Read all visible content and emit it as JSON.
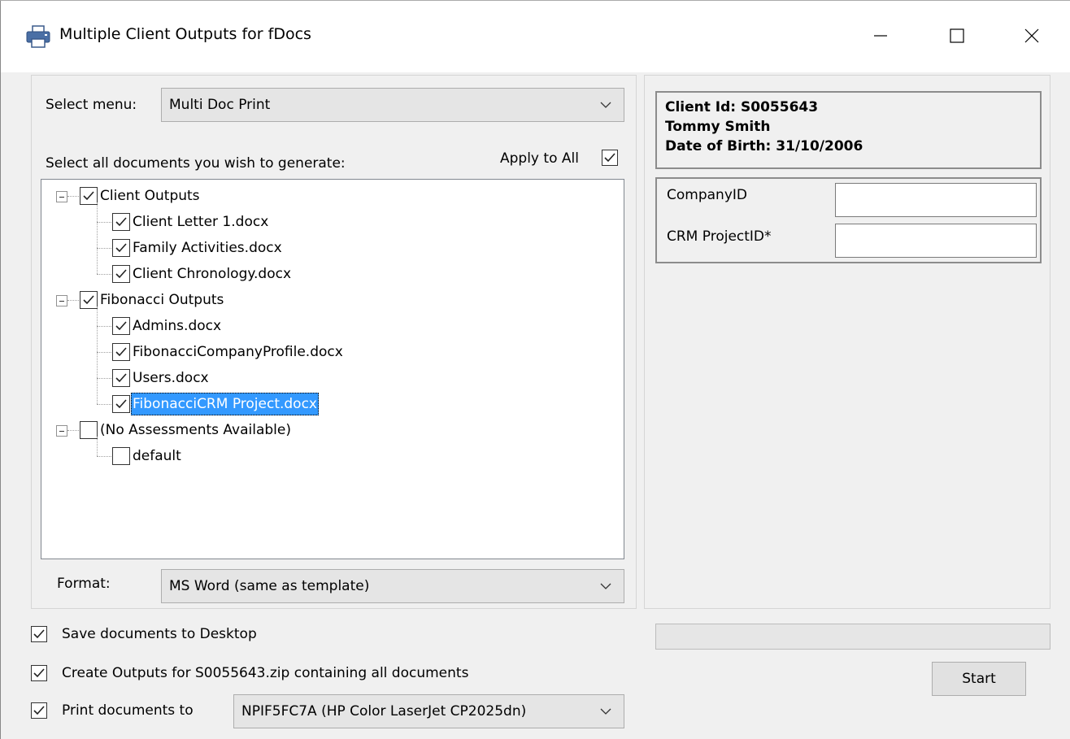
{
  "window": {
    "title": "Multiple Client Outputs for fDocs",
    "icons": {
      "app": "printer-icon",
      "minimize": "minimize-icon",
      "maximize": "maximize-icon",
      "close": "close-icon"
    }
  },
  "left": {
    "select_menu_label": "Select menu:",
    "select_menu_value": "Multi Doc Print",
    "documents_label": "Select all documents you wish to generate:",
    "apply_to_all_label": "Apply to All",
    "apply_to_all_checked": true,
    "tree": [
      {
        "label": "Client Outputs",
        "checked": true,
        "level": 0
      },
      {
        "label": "Client Letter 1.docx",
        "checked": true,
        "level": 1
      },
      {
        "label": "Family Activities.docx",
        "checked": true,
        "level": 1
      },
      {
        "label": "Client Chronology.docx",
        "checked": true,
        "level": 1
      },
      {
        "label": "Fibonacci Outputs",
        "checked": true,
        "level": 0
      },
      {
        "label": "Admins.docx",
        "checked": true,
        "level": 1
      },
      {
        "label": "FibonacciCompanyProfile.docx",
        "checked": true,
        "level": 1
      },
      {
        "label": "Users.docx",
        "checked": true,
        "level": 1
      },
      {
        "label": "FibonacciCRM Project.docx",
        "checked": true,
        "level": 1,
        "selected": true
      },
      {
        "label": "(No Assessments Available)",
        "checked": false,
        "level": 0
      },
      {
        "label": "default",
        "checked": false,
        "level": 1
      }
    ],
    "format_label": "Format:",
    "format_value": "MS Word (same as template)"
  },
  "right": {
    "client_id": "Client Id: S0055643",
    "client_name": "Tommy Smith",
    "dob": "Date of Birth: 31/10/2006",
    "company_id_label": "CompanyID",
    "company_id_value": "",
    "crm_project_label": "CRM ProjectID*",
    "crm_project_value": ""
  },
  "bottom": {
    "save_desktop_label": "Save documents to Desktop",
    "save_desktop_checked": true,
    "zip_label": "Create Outputs for S0055643.zip containing all documents",
    "zip_checked": true,
    "print_label": "Print documents to",
    "print_checked": true,
    "printer_value": "NPIF5FC7A (HP Color LaserJet CP2025dn)",
    "progress": 0,
    "start_label": "Start"
  }
}
